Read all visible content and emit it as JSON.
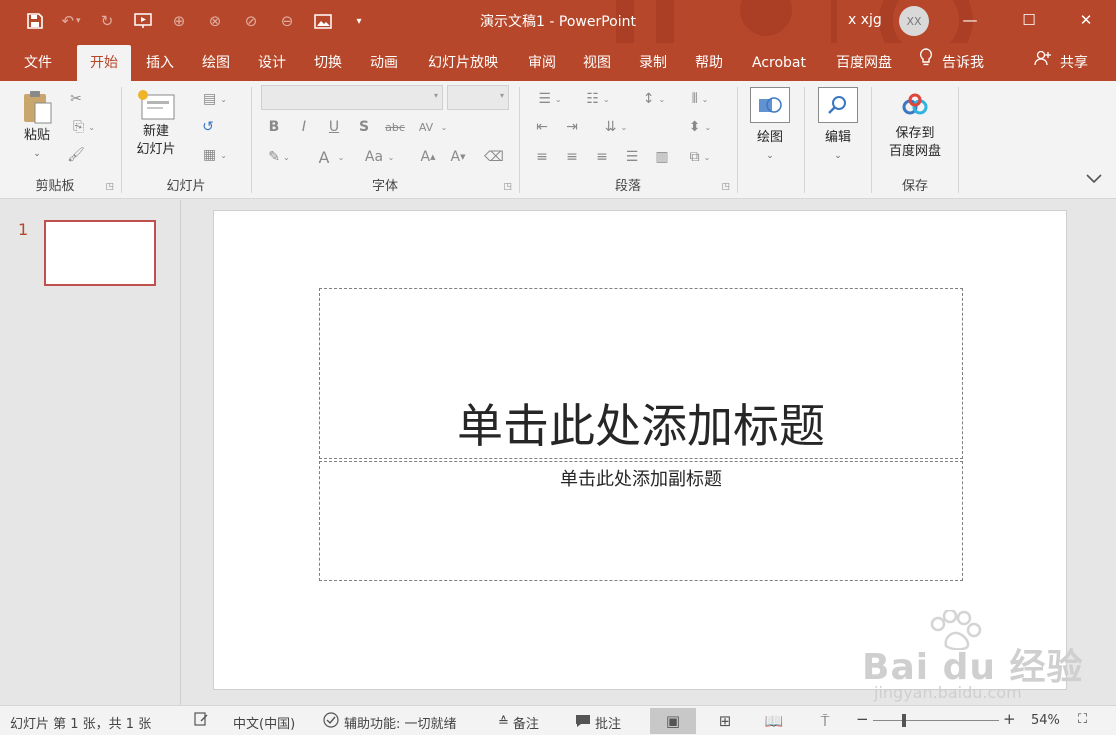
{
  "titlebar": {
    "doc_title": "演示文稿1  -  PowerPoint",
    "user_name": "x xjg",
    "avatar_initials": "XX",
    "accent": "#b7472a"
  },
  "tabs": [
    "文件",
    "开始",
    "插入",
    "绘图",
    "设计",
    "切换",
    "动画",
    "幻灯片放映",
    "审阅",
    "视图",
    "录制",
    "帮助",
    "Acrobat",
    "百度网盘"
  ],
  "active_tab": "开始",
  "tell_me": "告诉我",
  "share": "共享",
  "ribbon": {
    "clipboard": {
      "label": "剪贴板",
      "paste": "粘贴"
    },
    "slides": {
      "label": "幻灯片",
      "new_slide_line1": "新建",
      "new_slide_line2": "幻灯片"
    },
    "font": {
      "label": "字体",
      "bold": "B",
      "italic": "I",
      "underline": "U",
      "shadow": "S",
      "strike": "abc",
      "spacing": "AV",
      "color": "A",
      "case": "Aa"
    },
    "paragraph": {
      "label": "段落"
    },
    "drawing": {
      "label": "绘图"
    },
    "editing": {
      "label": "编辑"
    },
    "save": {
      "label": "保存",
      "save_line1": "保存到",
      "save_line2": "百度网盘"
    }
  },
  "thumbnails": {
    "slide_number": "1"
  },
  "slide": {
    "title_placeholder": "单击此处添加标题",
    "subtitle_placeholder": "单击此处添加副标题"
  },
  "watermark": {
    "brand": "Bai du 经验",
    "url": "jingyan.baidu.com"
  },
  "statusbar": {
    "slide_info": "幻灯片 第 1 张，共 1 张",
    "language": "中文(中国)",
    "accessibility": "辅助功能: 一切就绪",
    "notes": "备注",
    "comments": "批注",
    "zoom_level": "54%"
  }
}
